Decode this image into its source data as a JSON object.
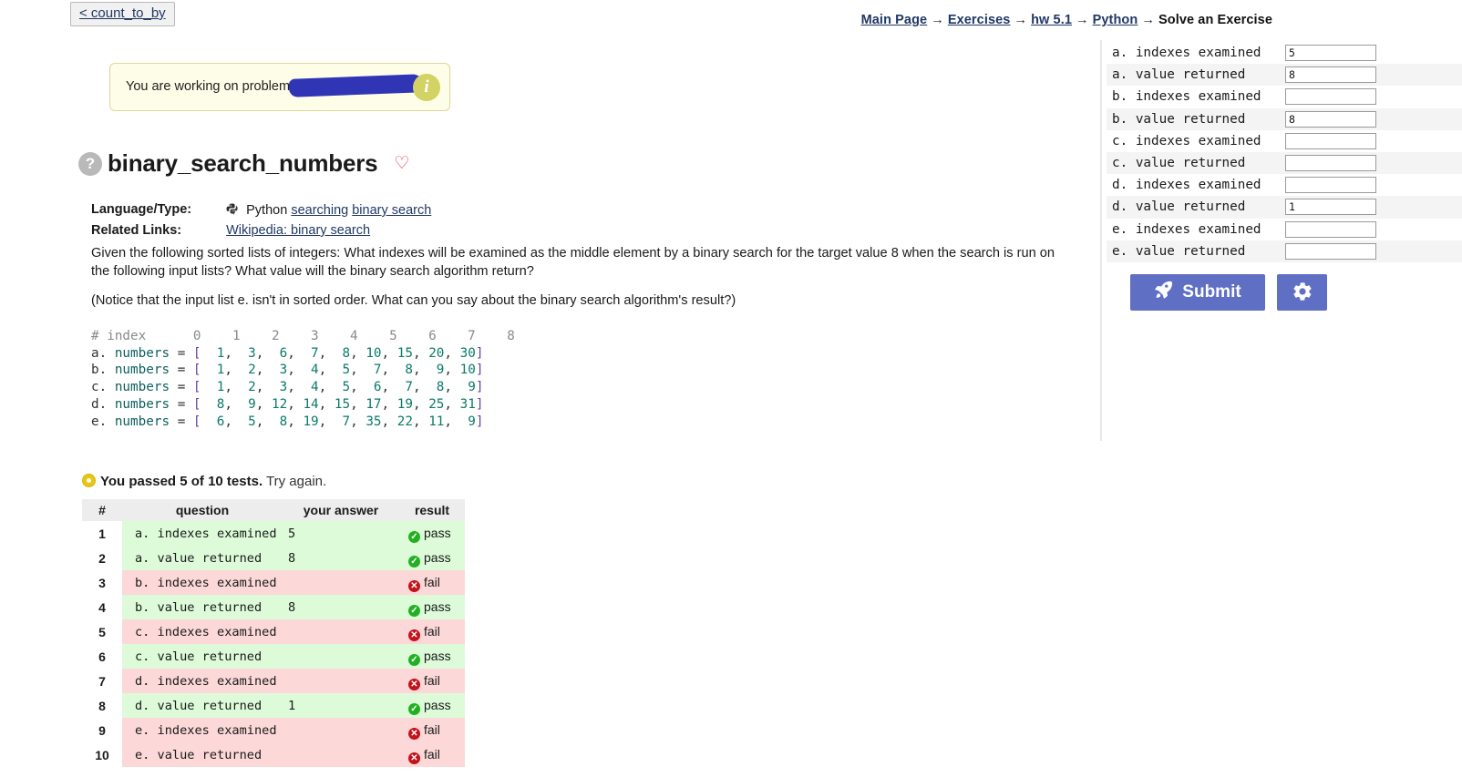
{
  "back_button": {
    "label": "< count_to_by"
  },
  "breadcrumb": {
    "items": [
      {
        "label": "Main Page",
        "link": true
      },
      {
        "label": "Exercises",
        "link": true
      },
      {
        "label": "hw 5.1",
        "link": true
      },
      {
        "label": "Python",
        "link": true
      },
      {
        "label": "Solve an Exercise",
        "link": false
      }
    ],
    "separator": "→"
  },
  "banner": {
    "text": "You are working on problem s",
    "info_icon": "i",
    "redacted": true
  },
  "exercise": {
    "title": "binary_search_numbers",
    "help_icon": "?",
    "favorite_icon": "♡",
    "meta": {
      "language_label": "Language/Type:",
      "language_value": "Python",
      "tags": [
        "searching",
        "binary search"
      ],
      "related_label": "Related Links:",
      "related_links": [
        "Wikipedia: binary search"
      ]
    },
    "prompt_paragraphs": [
      "Given the following sorted lists of integers: What indexes will be examined as the middle element by a binary search for the target value 8 when the search is run on the following input lists? What value will the binary search algorithm return?",
      "(Notice that the input list e. isn't in sorted order. What can you say about the binary search algorithm's result?)"
    ]
  },
  "code": {
    "header_comment": "#",
    "header_label": "index",
    "header_indexes": [
      "0",
      "1",
      "2",
      "3",
      "4",
      "5",
      "6",
      "7",
      "8"
    ],
    "lines": [
      {
        "letter": "a.",
        "name": "numbers",
        "values": [
          "1",
          "3",
          "6",
          "7",
          "8",
          "10",
          "15",
          "20",
          "30"
        ]
      },
      {
        "letter": "b.",
        "name": "numbers",
        "values": [
          "1",
          "2",
          "3",
          "4",
          "5",
          "7",
          "8",
          "9",
          "10"
        ]
      },
      {
        "letter": "c.",
        "name": "numbers",
        "values": [
          "1",
          "2",
          "3",
          "4",
          "5",
          "6",
          "7",
          "8",
          "9"
        ]
      },
      {
        "letter": "d.",
        "name": "numbers",
        "values": [
          "8",
          "9",
          "12",
          "14",
          "15",
          "17",
          "19",
          "25",
          "31"
        ]
      },
      {
        "letter": "e.",
        "name": "numbers",
        "values": [
          "6",
          "5",
          "8",
          "19",
          "7",
          "35",
          "22",
          "11",
          "9"
        ]
      }
    ]
  },
  "results": {
    "status_prefix": "You passed 5 of 10 tests.",
    "status_suffix": " Try again.",
    "passed": 5,
    "total": 10,
    "columns": [
      "#",
      "question",
      "your answer",
      "result"
    ],
    "rows": [
      {
        "n": "1",
        "question": "a. indexes examined",
        "answer": "5",
        "result": "pass"
      },
      {
        "n": "2",
        "question": "a. value returned",
        "answer": "8",
        "result": "pass"
      },
      {
        "n": "3",
        "question": "b. indexes examined",
        "answer": "",
        "result": "fail"
      },
      {
        "n": "4",
        "question": "b. value returned",
        "answer": "8",
        "result": "pass"
      },
      {
        "n": "5",
        "question": "c. indexes examined",
        "answer": "",
        "result": "fail"
      },
      {
        "n": "6",
        "question": "c. value returned",
        "answer": "",
        "result": "pass"
      },
      {
        "n": "7",
        "question": "d. indexes examined",
        "answer": "",
        "result": "fail"
      },
      {
        "n": "8",
        "question": "d. value returned",
        "answer": "1",
        "result": "pass"
      },
      {
        "n": "9",
        "question": "e. indexes examined",
        "answer": "",
        "result": "fail"
      },
      {
        "n": "10",
        "question": "e. value returned",
        "answer": "",
        "result": "fail"
      }
    ]
  },
  "answer_panel": {
    "fields": [
      {
        "label": "a. indexes examined",
        "value": "5"
      },
      {
        "label": "a. value returned",
        "value": "8"
      },
      {
        "label": "b. indexes examined",
        "value": ""
      },
      {
        "label": "b. value returned",
        "value": "8"
      },
      {
        "label": "c. indexes examined",
        "value": ""
      },
      {
        "label": "c. value returned",
        "value": ""
      },
      {
        "label": "d. indexes examined",
        "value": ""
      },
      {
        "label": "d. value returned",
        "value": "1"
      },
      {
        "label": "e. indexes examined",
        "value": ""
      },
      {
        "label": "e. value returned",
        "value": ""
      }
    ],
    "submit_label": "Submit",
    "submit_icon": "rocket-icon",
    "settings_icon": "gear-icon"
  },
  "colors": {
    "accent": "#5f6fc4",
    "pass_bg": "#ddfbd9",
    "fail_bg": "#fcd8d8",
    "pass_badge": "#22b022",
    "fail_badge": "#c4121a",
    "banner_bg": "#fdfde8",
    "link": "#1f3864",
    "redaction": "#2f35b5",
    "status_dot": "#e8c612"
  }
}
